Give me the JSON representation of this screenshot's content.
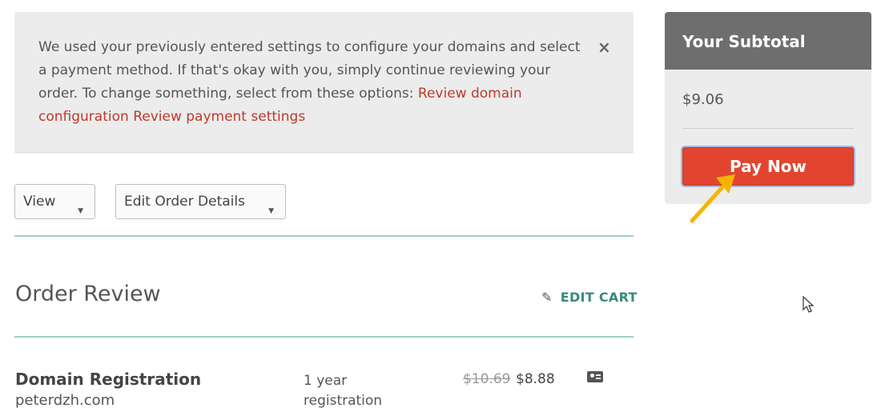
{
  "notice": {
    "text": "We used your previously entered settings to configure your domains and select a payment method. If that's okay with you, simply continue reviewing your order. To change something, select from these options: ",
    "link_domain": "Review domain configuration",
    "link_payment": "Review payment settings",
    "close_glyph": "×"
  },
  "controls": {
    "view_label": "View",
    "edit_order_label": "Edit Order Details",
    "caret": "▼"
  },
  "order_review": {
    "title": "Order Review",
    "edit_cart_label": "EDIT CART",
    "edit_cart_icon": "pencil-icon",
    "items": [
      {
        "title": "Domain Registration",
        "domain": "peterdzh.com",
        "term": "1 year registration",
        "old_price": "$10.69",
        "price": "$8.88",
        "icon": "contact-card-icon"
      }
    ]
  },
  "subtotal": {
    "title": "Your Subtotal",
    "amount": "$9.06",
    "pay_label": "Pay Now"
  },
  "colors": {
    "accent_link": "#c0392b",
    "teal": "#3a8a7d",
    "pay_button": "#e2452f",
    "annotation_arrow": "#f5b400"
  }
}
